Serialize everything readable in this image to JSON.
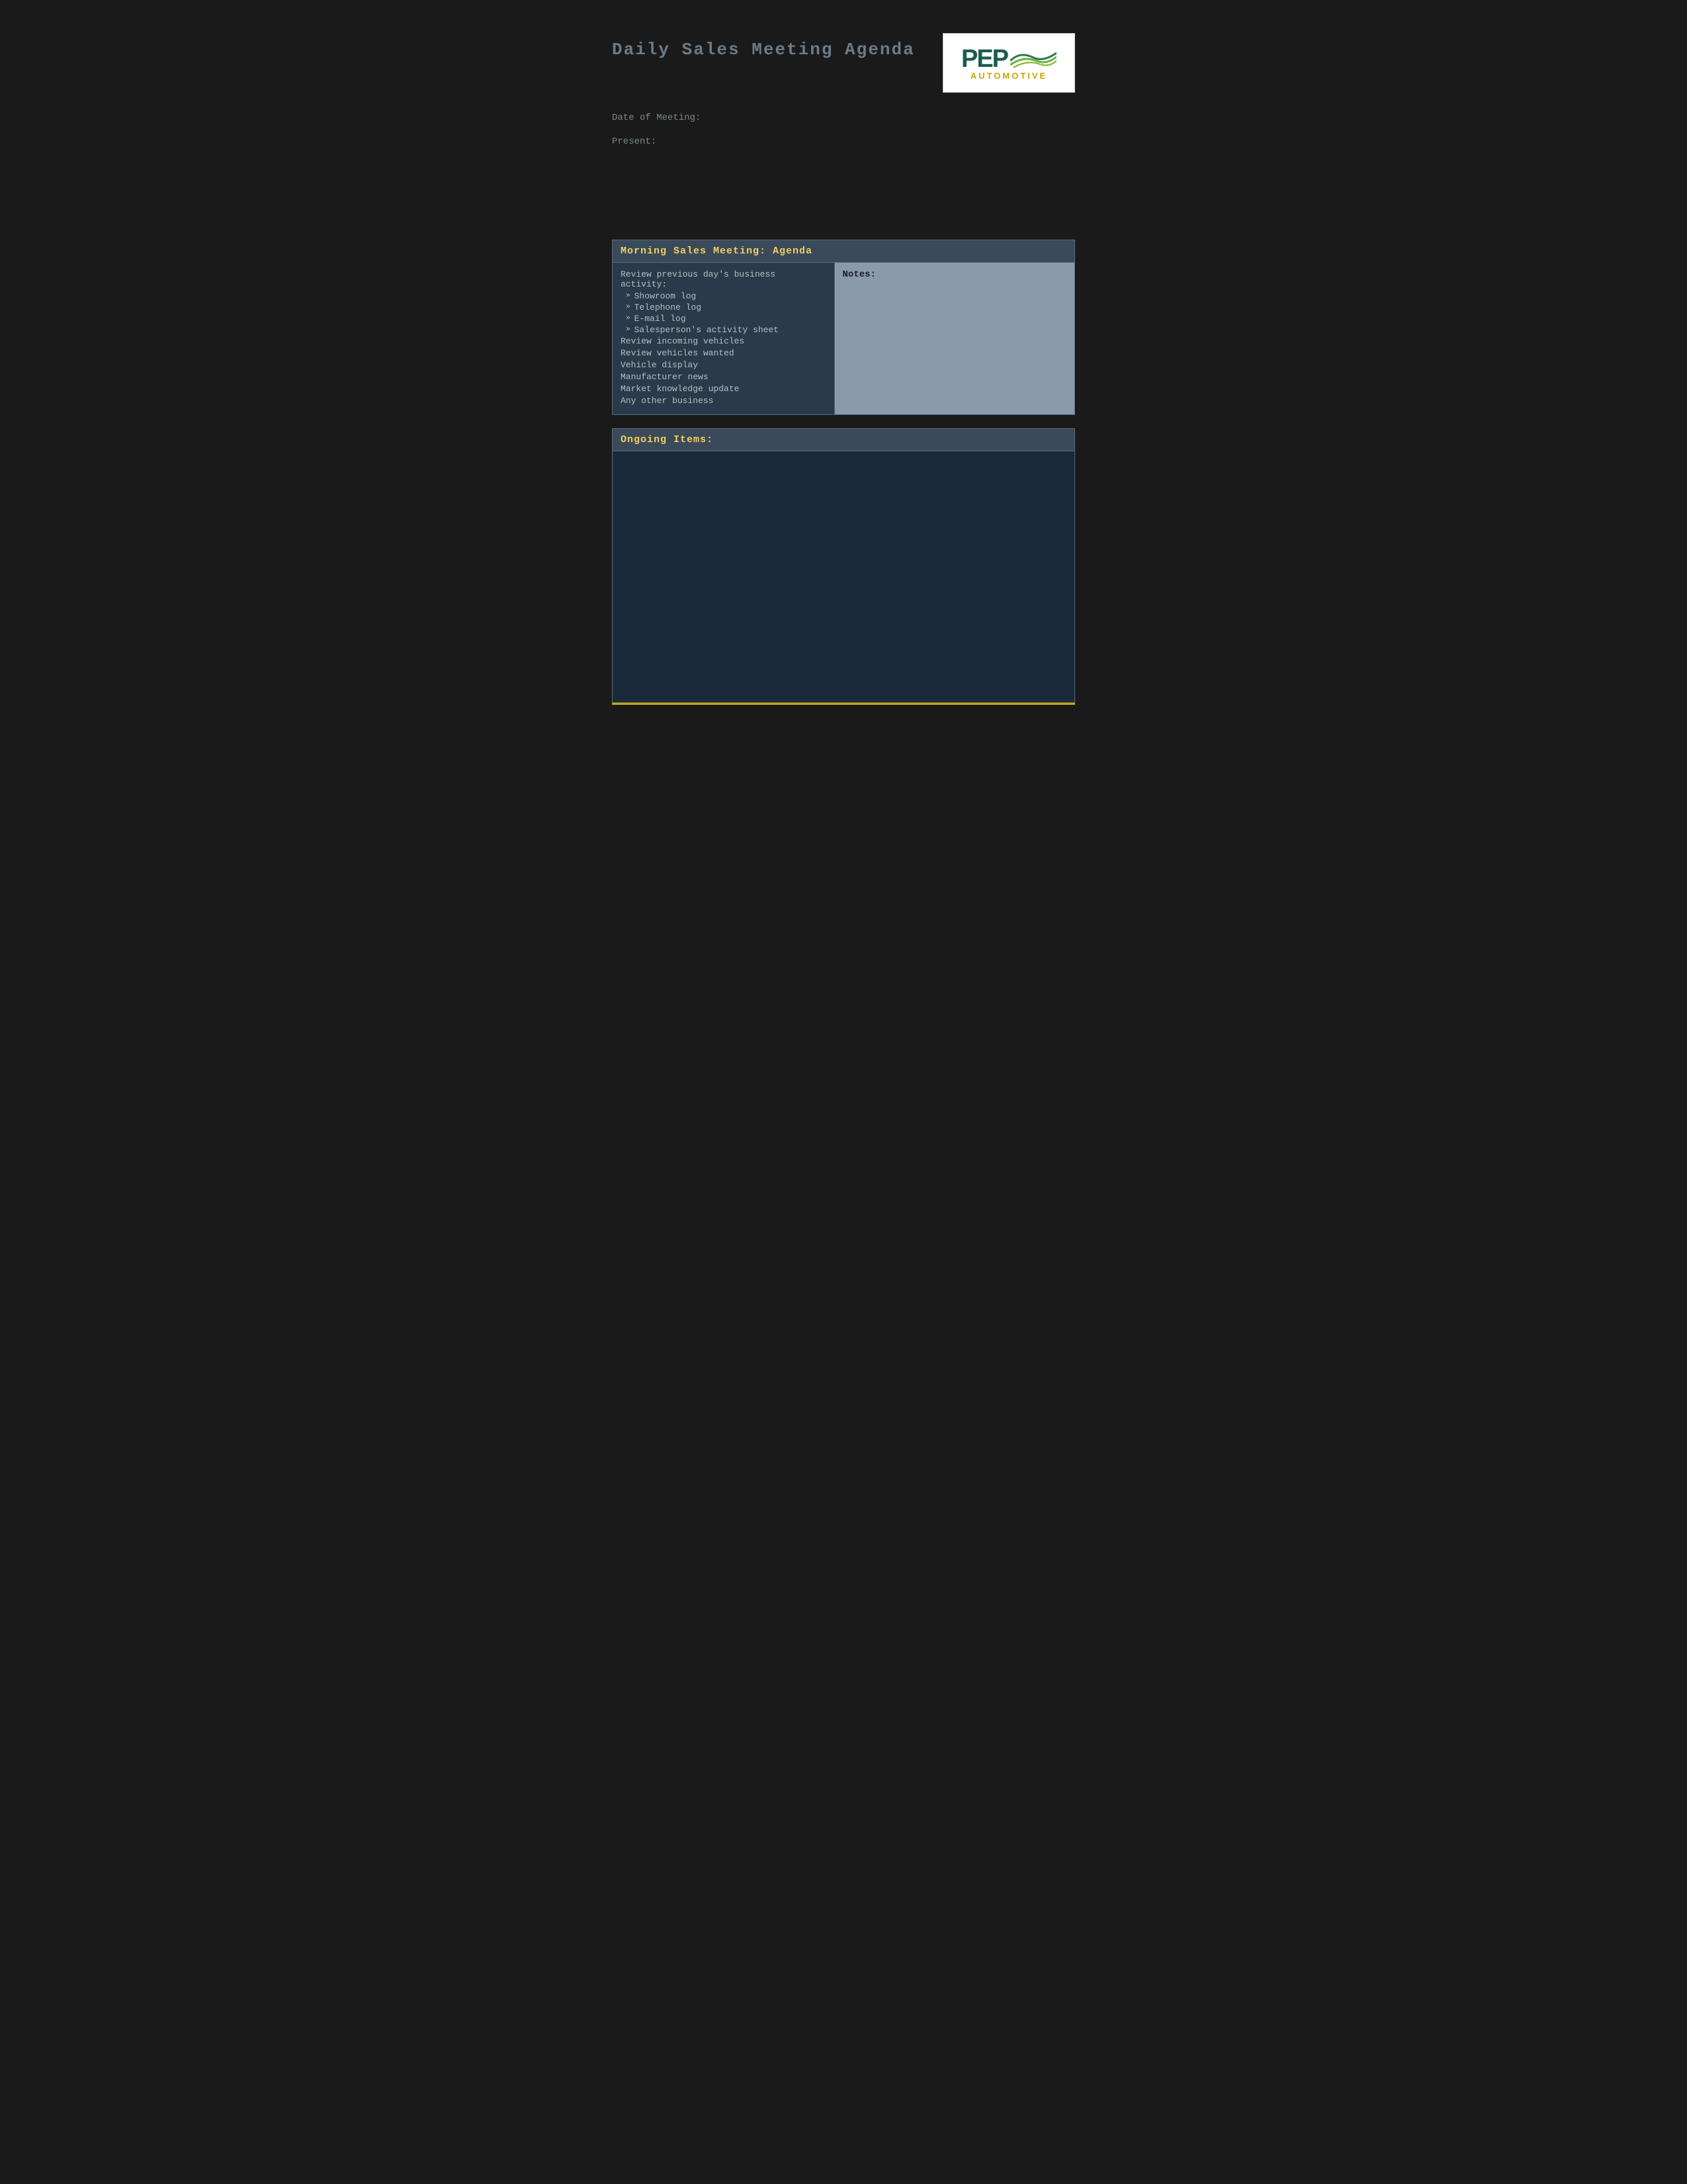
{
  "page": {
    "title": "Daily Sales Meeting Agenda",
    "background_color": "#1a1a1a"
  },
  "header": {
    "title": "Daily Sales Meeting Agenda",
    "logo": {
      "company": "PEP",
      "tagline": "AUTOMOTIVE"
    }
  },
  "meta": {
    "date_label": "Date of Meeting:",
    "present_label": "Present:"
  },
  "morning_section": {
    "header": "Morning Sales Meeting: Agenda",
    "agenda_intro": "Review previous day's business activity:",
    "sub_items": [
      "Showroom log",
      "Telephone log",
      "E-mail log",
      "Salesperson's activity sheet"
    ],
    "items": [
      "Review incoming vehicles",
      "Review vehicles wanted",
      "Vehicle display",
      "Manufacturer news",
      "Market knowledge update",
      "Any other business"
    ],
    "notes_label": "Notes:"
  },
  "ongoing_section": {
    "header": "Ongoing Items:"
  },
  "colors": {
    "header_bg": "#3a4a5a",
    "header_text": "#f0d060",
    "left_col_bg": "#2a3a4a",
    "right_col_bg": "#8a9aaa",
    "ongoing_body_bg": "#1a2a3a",
    "bottom_line": "#c8a800",
    "text_color": "#b0c0c0",
    "meta_color": "#7a8a7a"
  }
}
